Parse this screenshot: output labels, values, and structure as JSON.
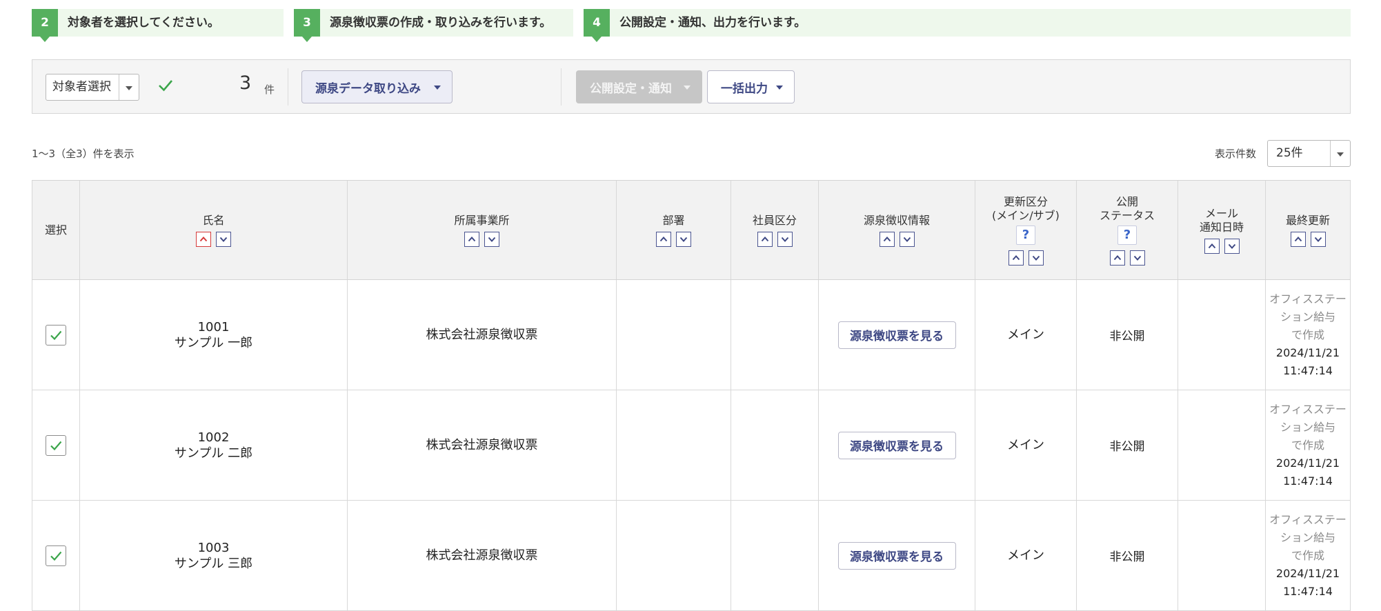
{
  "steps": [
    {
      "num": "2",
      "text": "対象者を選択してください。"
    },
    {
      "num": "3",
      "text": "源泉徴収票の作成・取り込みを行います。"
    },
    {
      "num": "4",
      "text": "公開設定・通知、出力を行います。"
    }
  ],
  "toolbar": {
    "target_select_label": "対象者選択",
    "count": "3",
    "count_unit": "件",
    "import_label": "源泉データ取り込み",
    "publish_label": "公開設定・通知",
    "export_label": "一括出力"
  },
  "list_info": "1～3（全3）件を表示",
  "per_page": {
    "label": "表示件数",
    "value": "25件"
  },
  "columns": {
    "select": "選択",
    "name": "氏名",
    "office": "所属事業所",
    "dept": "部署",
    "emp_type": "社員区分",
    "withholding": "源泉徴収情報",
    "update_type_1": "更新区分",
    "update_type_2": "(メイン/サブ)",
    "pub_status_1": "公開",
    "pub_status_2": "ステータス",
    "mail_1": "メール",
    "mail_2": "通知日時",
    "last_update": "最終更新",
    "help": "?"
  },
  "rows": [
    {
      "id": "1001",
      "name": "サンプル 一郎",
      "office": "株式会社源泉徴収票",
      "dept": "",
      "emp_type": "",
      "view_label": "源泉徴収票を見る",
      "update_type": "メイン",
      "status": "非公開",
      "mail": "",
      "upd1": "オフィスステー",
      "upd2": "ション給与",
      "upd3": "で作成",
      "upd_date": "2024/11/21",
      "upd_time": "11:47:14",
      "checked": true
    },
    {
      "id": "1002",
      "name": "サンプル 二郎",
      "office": "株式会社源泉徴収票",
      "dept": "",
      "emp_type": "",
      "view_label": "源泉徴収票を見る",
      "update_type": "メイン",
      "status": "非公開",
      "mail": "",
      "upd1": "オフィスステー",
      "upd2": "ション給与",
      "upd3": "で作成",
      "upd_date": "2024/11/21",
      "upd_time": "11:47:14",
      "checked": true
    },
    {
      "id": "1003",
      "name": "サンプル 三郎",
      "office": "株式会社源泉徴収票",
      "dept": "",
      "emp_type": "",
      "view_label": "源泉徴収票を見る",
      "update_type": "メイン",
      "status": "非公開",
      "mail": "",
      "upd1": "オフィスステー",
      "upd2": "ション給与",
      "upd3": "で作成",
      "upd_date": "2024/11/21",
      "upd_time": "11:47:14",
      "checked": true
    }
  ],
  "colors": {
    "step_green": "#56b05f",
    "accent_navy": "#3e4884",
    "check_green": "#3aa54a",
    "sort_active": "#d63a3a"
  },
  "icons": {
    "sort_asc": "chevron-up-icon",
    "sort_desc": "chevron-down-icon",
    "help": "question-icon",
    "check": "check-icon"
  }
}
